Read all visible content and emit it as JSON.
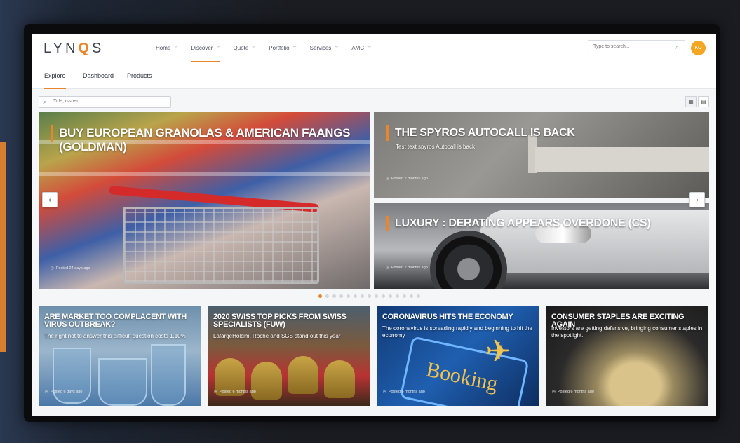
{
  "app": {
    "logo_prefix": "LYN",
    "logo_q": "Q",
    "logo_suffix": "S"
  },
  "nav": {
    "items": [
      {
        "label": "Home"
      },
      {
        "label": "Discover"
      },
      {
        "label": "Quote"
      },
      {
        "label": "Portfolio"
      },
      {
        "label": "Services"
      },
      {
        "label": "AMC"
      }
    ],
    "active": "Discover"
  },
  "search": {
    "placeholder": "Type to search..."
  },
  "user": {
    "initials": "KO"
  },
  "tabs": [
    {
      "label": "Explore"
    },
    {
      "label": "Dashboard"
    },
    {
      "label": "Products"
    }
  ],
  "filter": {
    "placeholder": "Title, issuer"
  },
  "hero": {
    "main": {
      "title": "Buy European Granolas & American FAANGs (Goldman)",
      "posted": "Posted 24 days ago"
    },
    "top_right": {
      "title": "The Spyros Autocall is back",
      "subtitle": "Test text spyros Autocall is back",
      "posted": "Posted 2 months ago"
    },
    "bottom_right": {
      "title": "Luxury : derating appears overdone (CS)",
      "posted": "Posted 2 months ago"
    }
  },
  "carousel": {
    "total": 15,
    "current": 1
  },
  "cards": [
    {
      "title": "Are market too complacent with virus outbreak?",
      "subtitle": "The right not to answer this difficult question costs 1.10%",
      "posted": "Posted 6 days ago"
    },
    {
      "title": "2020 Swiss top picks from Swiss specialists (FUW)",
      "subtitle": "LafargeHolcim, Roche and SGS stand out this year",
      "posted": "Posted 6 months ago"
    },
    {
      "title": "Coronavirus hits the economy",
      "subtitle": "The coronavirus is spreading rapidly and beginning to hit the economy",
      "posted": "Posted 6 months ago"
    },
    {
      "title": "Consumer staples are exciting again",
      "subtitle": "Investors are getting defensive, bringing consumer staples in the spotlight.",
      "posted": "Posted 6 months ago"
    }
  ],
  "images": {
    "booking_word": "Booking"
  }
}
